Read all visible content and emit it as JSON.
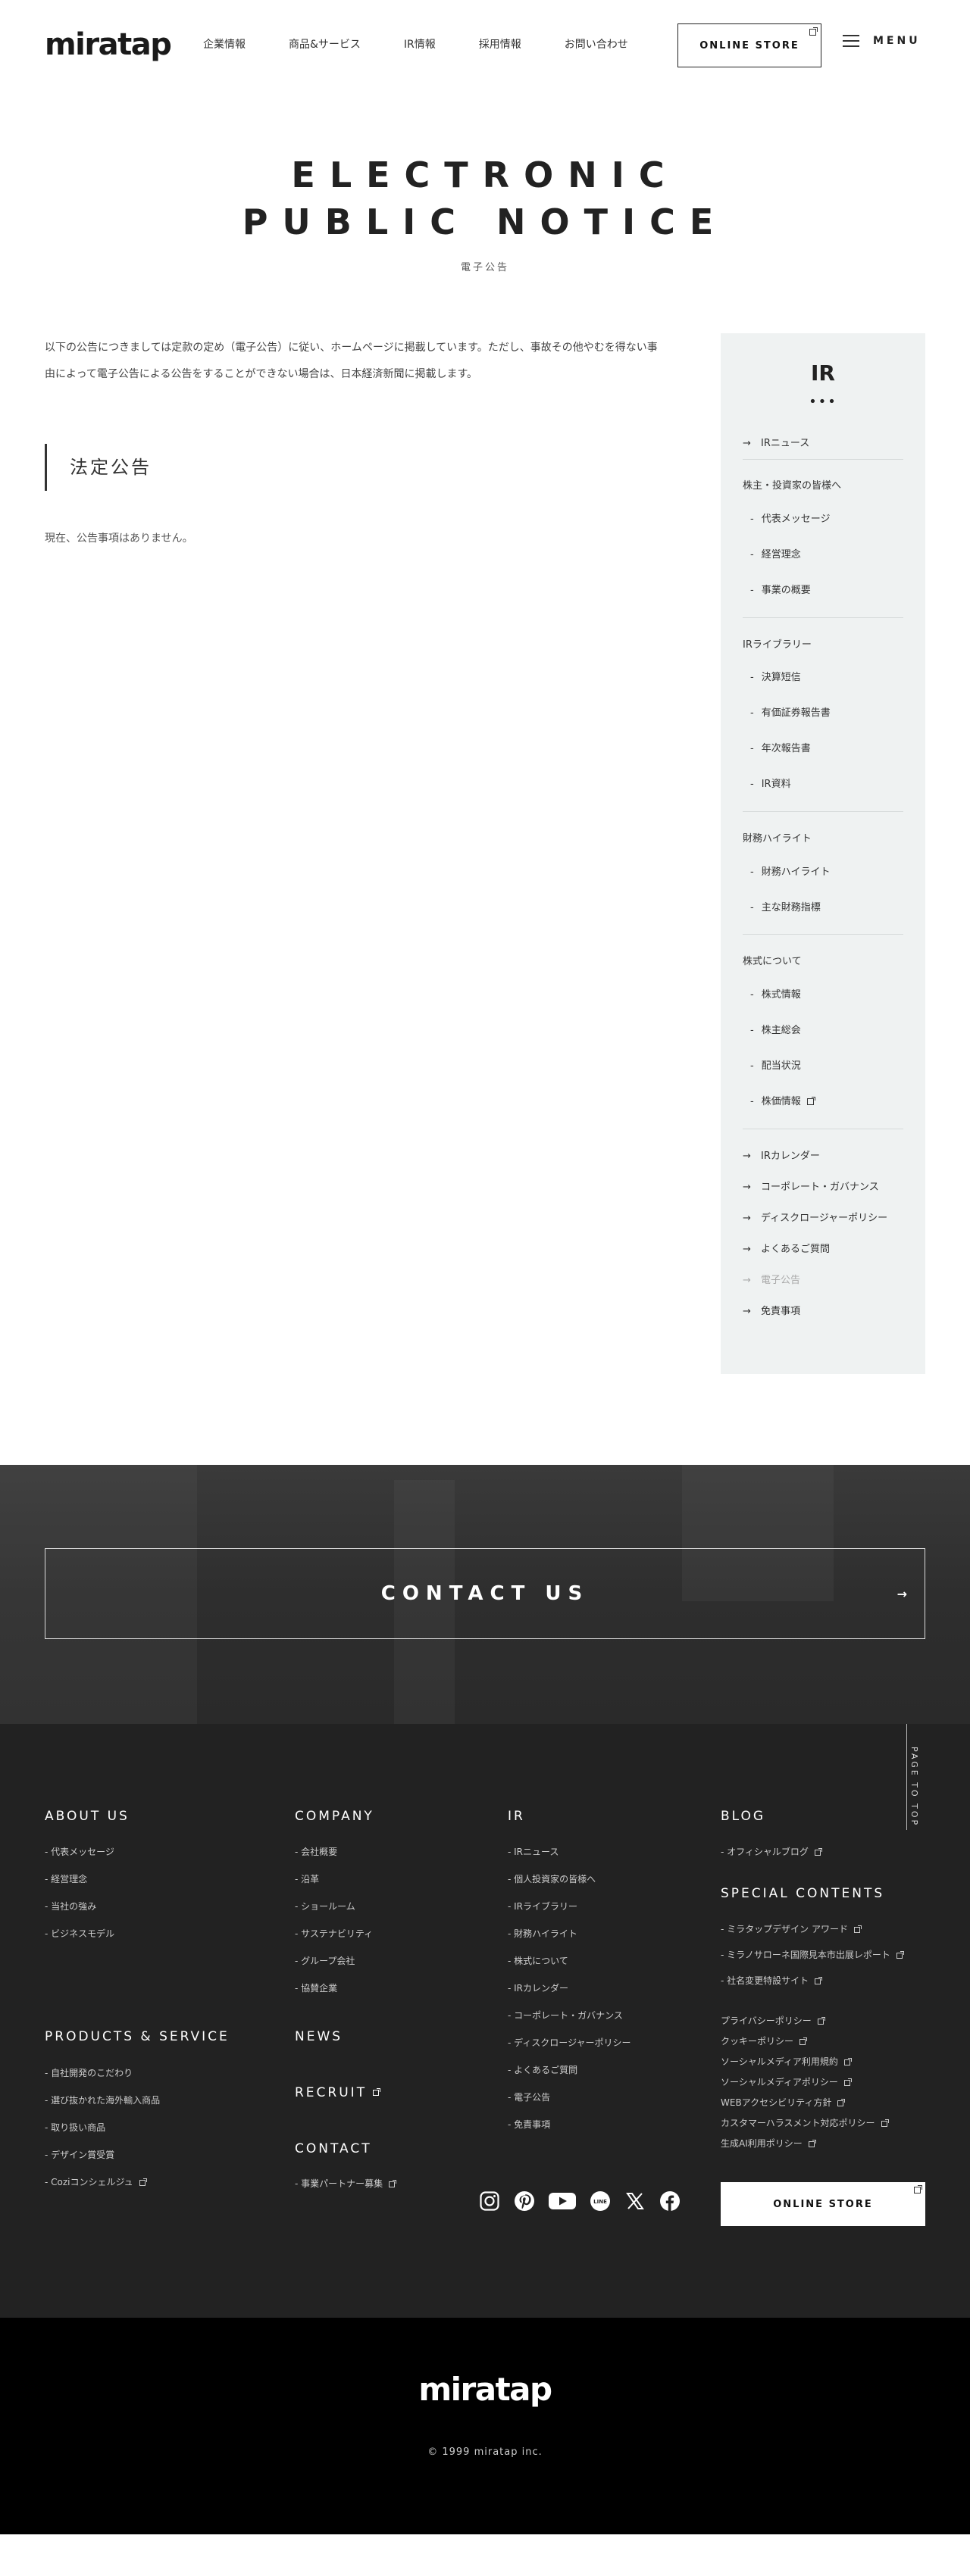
{
  "header": {
    "logo": "miratap",
    "nav": [
      "企業情報",
      "商品&サービス",
      "IR情報",
      "採用情報",
      "お問い合わせ"
    ],
    "online_store": "ONLINE STORE",
    "menu": "MENU"
  },
  "title": {
    "line1": "ELECTRONIC",
    "line2": "PUBLIC NOTICE",
    "sub": "電子公告"
  },
  "main": {
    "intro_line1": "以下の公告につきましては定款の定め（電子公告）に従い、ホームページに掲載しています。ただし、事故その他やむを得ない事",
    "intro_line2": "由によって電子公告による公告をすることができない場合は、日本経済新聞に掲載します。",
    "section_heading": "法定公告",
    "no_notice": "現在、公告事項はありません。"
  },
  "sidebar": {
    "title": "IR",
    "dots": "•••",
    "ir_news": "IRニュース",
    "cat1": "株主・投資家の皆様へ",
    "cat1_items": [
      "代表メッセージ",
      "経営理念",
      "事業の概要"
    ],
    "cat2": "IRライブラリー",
    "cat2_items": [
      "決算短信",
      "有価証券報告書",
      "年次報告書",
      "IR資料"
    ],
    "cat3": "財務ハイライト",
    "cat3_items": [
      "財務ハイライト",
      "主な財務指標"
    ],
    "cat4": "株式について",
    "cat4_items": [
      "株式情報",
      "株主総会",
      "配当状況",
      "株価情報"
    ],
    "links": [
      "IRカレンダー",
      "コーポレート・ガバナンス",
      "ディスクロージャーポリシー",
      "よくあるご質問",
      "電子公告",
      "免責事項"
    ]
  },
  "contact": {
    "label": "CONTACT US"
  },
  "footer": {
    "about_head": "ABOUT US",
    "about_items": [
      "- 代表メッセージ",
      "- 経営理念",
      "- 当社の強み",
      "- ビジネスモデル"
    ],
    "company_head": "COMPANY",
    "company_items": [
      "- 会社概要",
      "- 沿革",
      "- ショールーム",
      "- サステナビリティ",
      "- グループ会社",
      "- 協賛企業"
    ],
    "ir_head": "IR",
    "ir_items": [
      "- IRニュース",
      "- 個人投資家の皆様へ",
      "- IRライブラリー",
      "- 財務ハイライト",
      "- 株式について",
      "- IRカレンダー",
      "- コーポレート・ガバナンス",
      "- ディスクロージャーポリシー",
      "- よくあるご質問",
      "- 電子公告",
      "- 免責事項"
    ],
    "blog_head": "BLOG",
    "blog_items": [
      "- オフィシャルブログ"
    ],
    "special_head": "SPECIAL CONTENTS",
    "special_items": [
      "- ミラタップデザイン アワード",
      "- ミラノサローネ国際見本市出展レポート",
      "- 社名変更特設サイト"
    ],
    "policy_items": [
      "プライバシーポリシー",
      "クッキーポリシー",
      "ソーシャルメディア利用規約",
      "ソーシャルメディアポリシー",
      "WEBアクセシビリティ方針",
      "カスタマーハラスメント対応ポリシー",
      "生成AI利用ポリシー"
    ],
    "products_head": "PRODUCTS & SERVICE",
    "products_items": [
      "- 自社開発のこだわり",
      "- 選び抜かれた海外輸入商品",
      "- 取り扱い商品",
      "- デザイン賞受賞",
      "- Coziコンシェルジュ"
    ],
    "news_head": "NEWS",
    "recruit_head": "RECRUIT",
    "contact_head": "CONTACT",
    "contact_items": [
      "- 事業パートナー募集"
    ],
    "page_top": "PAGE TO TOP",
    "online_store": "ONLINE STORE",
    "social_icons": [
      "instagram-icon",
      "pinterest-icon",
      "youtube-icon",
      "line-icon",
      "x-icon",
      "facebook-icon"
    ]
  },
  "bottom": {
    "logo": "miratap",
    "copyright": "© 1999 miratap inc."
  }
}
